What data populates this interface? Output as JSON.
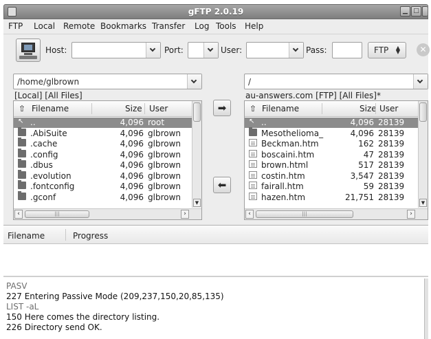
{
  "window": {
    "title": "gFTP 2.0.19"
  },
  "menu": [
    "FTP",
    "Local",
    "Remote",
    "Bookmarks",
    "Transfer",
    "Log",
    "Tools",
    "Help"
  ],
  "toolbar": {
    "host_label": "Host:",
    "host_value": "",
    "port_label": "Port:",
    "port_value": "",
    "user_label": "User:",
    "user_value": "",
    "pass_label": "Pass:",
    "pass_value": "",
    "protocol": "FTP"
  },
  "local": {
    "path": "/home/glbrown",
    "status": "[Local] [All Files]",
    "columns": {
      "filename": "Filename",
      "size": "Size",
      "user": "User"
    },
    "files": [
      {
        "name": "..",
        "size": "4,096",
        "user": "root",
        "icon": "up-arrow-icon",
        "selected": true
      },
      {
        "name": ".AbiSuite",
        "size": "4,096",
        "user": "glbrown",
        "icon": "folder-icon"
      },
      {
        "name": ".cache",
        "size": "4,096",
        "user": "glbrown",
        "icon": "folder-icon"
      },
      {
        "name": ".config",
        "size": "4,096",
        "user": "glbrown",
        "icon": "folder-icon"
      },
      {
        "name": ".dbus",
        "size": "4,096",
        "user": "glbrown",
        "icon": "folder-icon"
      },
      {
        "name": ".evolution",
        "size": "4,096",
        "user": "glbrown",
        "icon": "folder-icon"
      },
      {
        "name": ".fontconfig",
        "size": "4,096",
        "user": "glbrown",
        "icon": "folder-icon"
      },
      {
        "name": ".gconf",
        "size": "4,096",
        "user": "glbrown",
        "icon": "folder-icon"
      }
    ]
  },
  "remote": {
    "path": "/",
    "status": "au-answers.com [FTP] [All Files]*",
    "columns": {
      "filename": "Filename",
      "size": "Size",
      "user": "User"
    },
    "files": [
      {
        "name": "..",
        "size": "4,096",
        "user": "28139",
        "icon": "up-arrow-icon",
        "selected": true
      },
      {
        "name": "Mesothelioma_",
        "size": "4,096",
        "user": "28139",
        "icon": "folder-icon"
      },
      {
        "name": "Beckman.htm",
        "size": "162",
        "user": "28139",
        "icon": "file-icon"
      },
      {
        "name": "boscaini.htm",
        "size": "47",
        "user": "28139",
        "icon": "file-icon"
      },
      {
        "name": "brown.html",
        "size": "517",
        "user": "28139",
        "icon": "file-icon"
      },
      {
        "name": "costin.htm",
        "size": "3,547",
        "user": "28139",
        "icon": "file-icon"
      },
      {
        "name": "fairall.htm",
        "size": "59",
        "user": "28139",
        "icon": "file-icon"
      },
      {
        "name": "hazen.htm",
        "size": "21,751",
        "user": "28139",
        "icon": "file-icon"
      }
    ]
  },
  "transfer": {
    "columns": {
      "filename": "Filename",
      "progress": "Progress"
    }
  },
  "log": [
    {
      "text": "PASV",
      "type": "cmd"
    },
    {
      "text": "227 Entering Passive Mode (209,237,150,20,85,135)",
      "type": "resp"
    },
    {
      "text": "LIST -aL",
      "type": "cmd"
    },
    {
      "text": "150 Here comes the directory listing.",
      "type": "resp"
    },
    {
      "text": "226 Directory send OK.",
      "type": "resp"
    }
  ]
}
